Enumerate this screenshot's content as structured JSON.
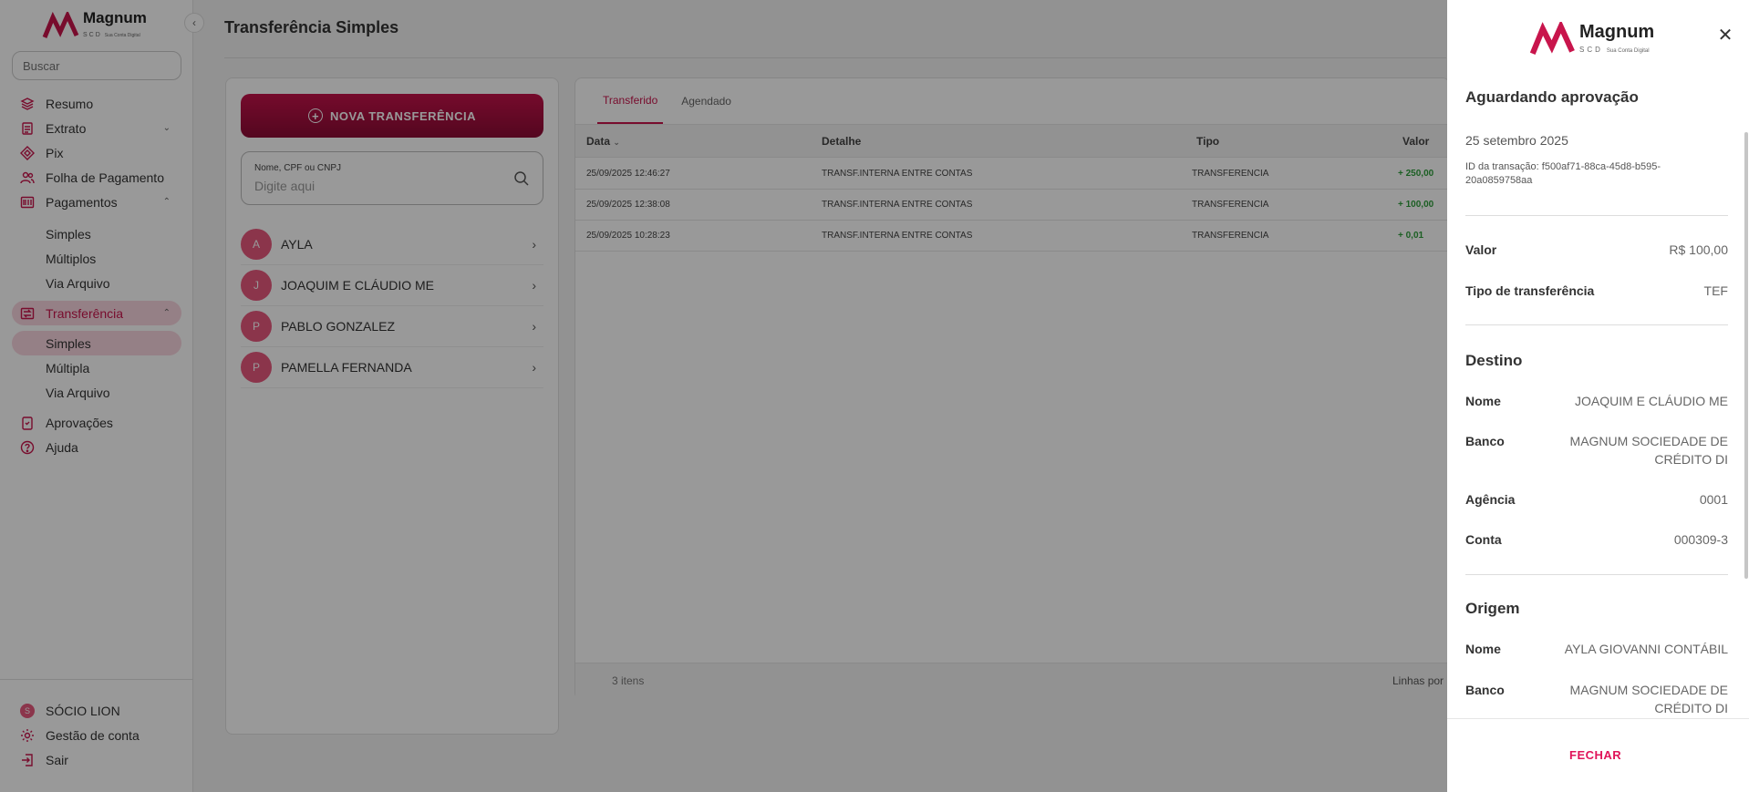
{
  "sidebar": {
    "logo_brand": "Magnum",
    "logo_sub": "SCD",
    "logo_tag": "Sua Conta Digital",
    "search_placeholder": "Buscar",
    "items": [
      {
        "label": "Resumo",
        "icon": "layers-icon"
      },
      {
        "label": "Extrato",
        "icon": "document-icon"
      },
      {
        "label": "Pix",
        "icon": "pix-icon"
      },
      {
        "label": "Folha de Pagamento",
        "icon": "users-icon"
      },
      {
        "label": "Pagamentos",
        "icon": "barcode-icon"
      },
      {
        "label": "Transferência",
        "icon": "transfer-icon"
      },
      {
        "label": "Aprovações",
        "icon": "clipboard-icon"
      },
      {
        "label": "Ajuda",
        "icon": "help-icon"
      }
    ],
    "pagamentos_sub": [
      "Simples",
      "Múltiplos",
      "Via Arquivo"
    ],
    "transferencia_sub": [
      "Simples",
      "Múltipla",
      "Via Arquivo"
    ],
    "footer": {
      "user_initial": "S",
      "user": "SÓCIO LION",
      "account": "Gestão de conta",
      "logout": "Sair"
    }
  },
  "main": {
    "title": "Transferência Simples",
    "new_button": "NOVA TRANSFERÊNCIA",
    "search_label": "Nome, CPF ou CNPJ",
    "search_placeholder": "Digite aqui",
    "contacts": [
      {
        "initial": "A",
        "name": "AYLA"
      },
      {
        "initial": "J",
        "name": "JOAQUIM E CLÁUDIO ME"
      },
      {
        "initial": "P",
        "name": "PABLO GONZALEZ"
      },
      {
        "initial": "P",
        "name": "PAMELLA FERNANDA"
      }
    ],
    "tabs": [
      "Transferido",
      "Agendado"
    ],
    "table_headers": {
      "data": "Data",
      "detalhe": "Detalhe",
      "tipo": "Tipo",
      "valor": "Valor"
    },
    "rows": [
      {
        "data": "25/09/2025 12:46:27",
        "detalhe": "TRANSF.INTERNA ENTRE CONTAS",
        "tipo": "TRANSFERENCIA",
        "valor": "+ 250,00"
      },
      {
        "data": "25/09/2025 12:38:08",
        "detalhe": "TRANSF.INTERNA ENTRE CONTAS",
        "tipo": "TRANSFERENCIA",
        "valor": "+ 100,00"
      },
      {
        "data": "25/09/2025 10:28:23",
        "detalhe": "TRANSF.INTERNA ENTRE CONTAS",
        "tipo": "TRANSFERENCIA",
        "valor": "+ 0,01"
      }
    ],
    "count": "3 itens",
    "rows_per_page": "Linhas por"
  },
  "drawer": {
    "logo_brand": "Magnum",
    "logo_sub": "SCD",
    "logo_tag": "Sua Conta Digital",
    "status": "Aguardando aprovação",
    "date": "25 setembro 2025",
    "transaction_id": "ID da transação: f500af71-88ca-45d8-b595-20a0859758aa",
    "valor_label": "Valor",
    "valor": "R$ 100,00",
    "tipo_label": "Tipo de transferência",
    "tipo": "TEF",
    "destino_title": "Destino",
    "destino": {
      "nome_label": "Nome",
      "nome": "JOAQUIM E CLÁUDIO ME",
      "banco_label": "Banco",
      "banco": "MAGNUM SOCIEDADE DE CRÉDITO DI",
      "agencia_label": "Agência",
      "agencia": "0001",
      "conta_label": "Conta",
      "conta": "000309-3"
    },
    "origem_title": "Origem",
    "origem": {
      "nome_label": "Nome",
      "nome": "AYLA GIOVANNI CONTÁBIL",
      "banco_label": "Banco",
      "banco": "MAGNUM SOCIEDADE DE CRÉDITO DI"
    },
    "close_button": "FECHAR"
  },
  "colors": {
    "accent": "#c8154c",
    "positive": "#2e9e3b",
    "overlay": "rgba(0,0,0,0.4)"
  }
}
